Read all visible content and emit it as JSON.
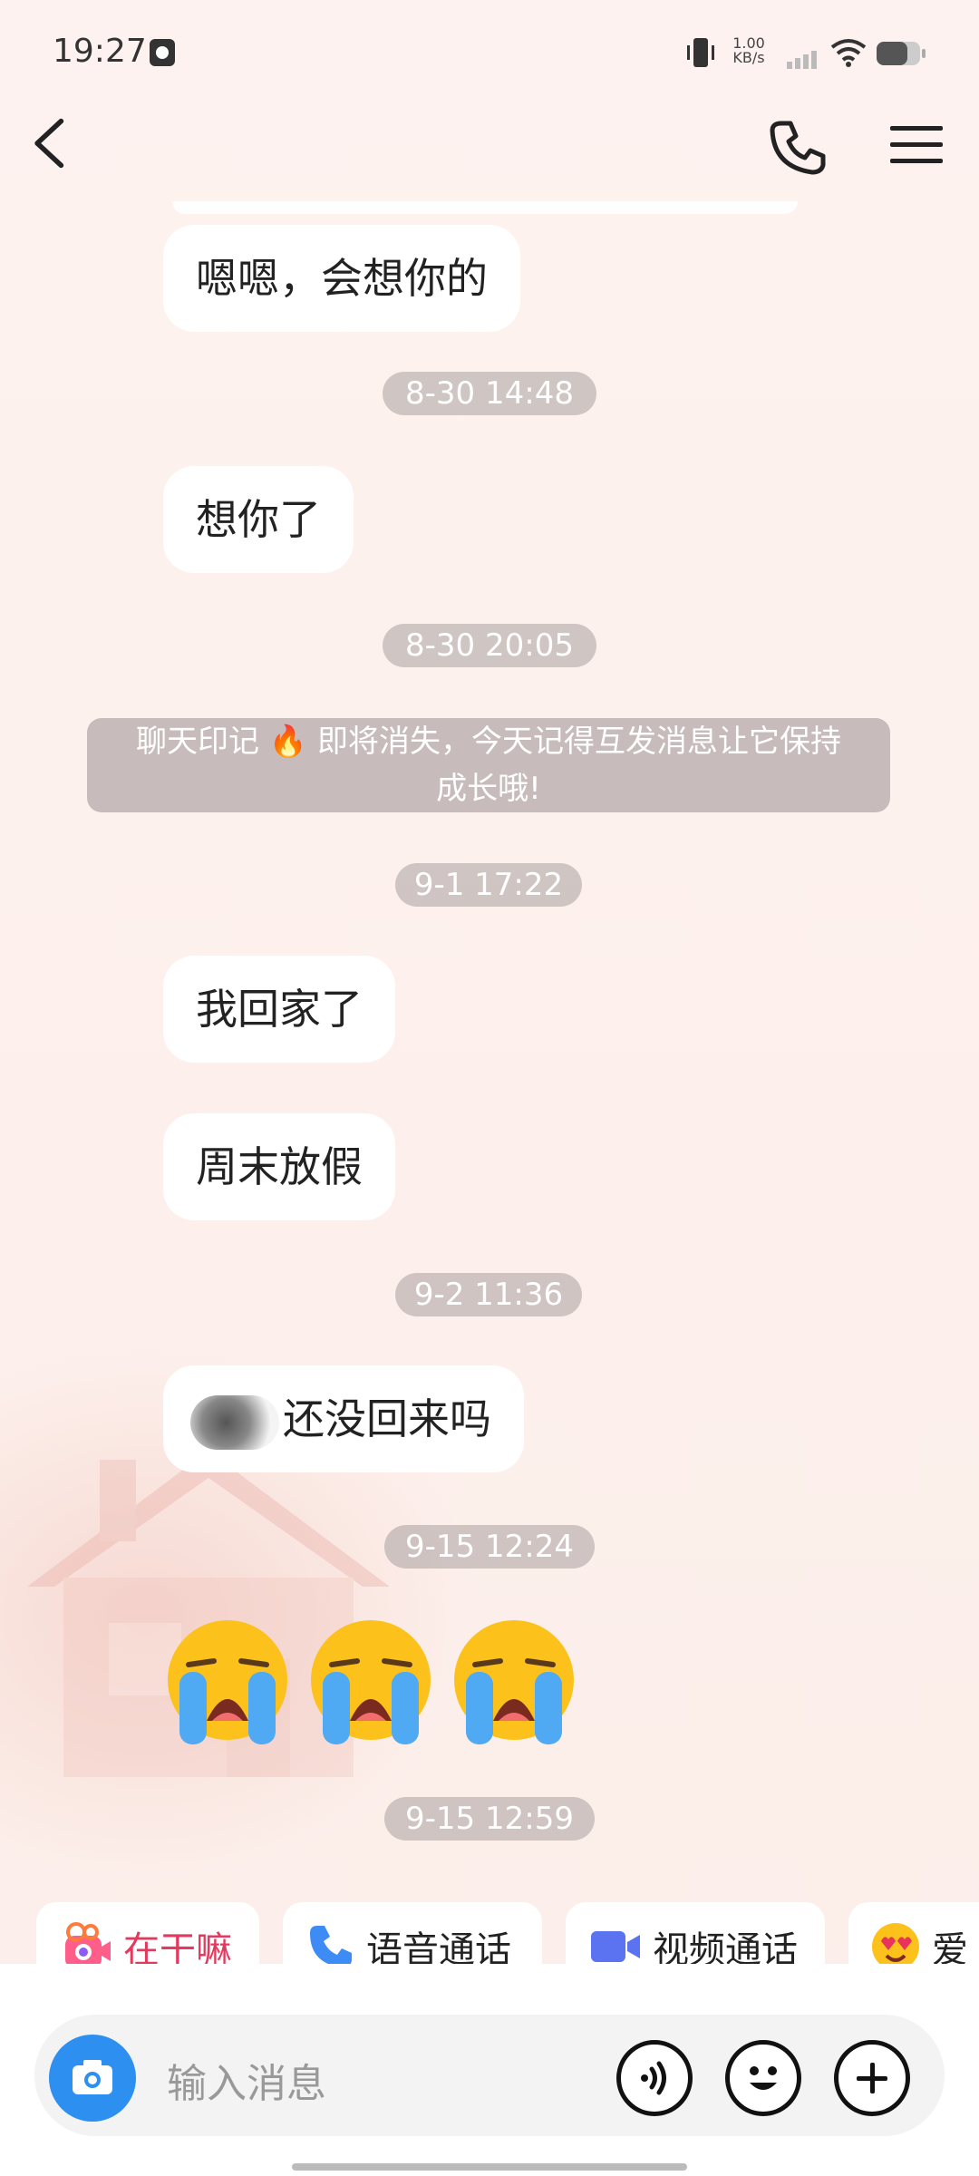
{
  "status": {
    "time": "19:27",
    "net_speed": "1.00",
    "net_unit": "KB/s"
  },
  "messages": [
    {
      "type": "text",
      "text": "嗯嗯，会想你的"
    },
    {
      "type": "time",
      "text": "8-30 14:48"
    },
    {
      "type": "text",
      "text": "想你了"
    },
    {
      "type": "time",
      "text": "8-30 20:05"
    },
    {
      "type": "system",
      "line1": "聊天印记 🔥 即将消失，今天记得互发消息让它保持",
      "line2": "成长哦!"
    },
    {
      "type": "time",
      "text": "9-1 17:22"
    },
    {
      "type": "text",
      "text": "我回家了"
    },
    {
      "type": "text",
      "text": "周末放假"
    },
    {
      "type": "time",
      "text": "9-2 11:36"
    },
    {
      "type": "text",
      "text": "还没回来吗"
    },
    {
      "type": "time",
      "text": "9-15 12:24"
    },
    {
      "type": "emoji",
      "text": "😭 😭 😭",
      "icons": [
        "loudly-crying-face-icon",
        "loudly-crying-face-icon",
        "loudly-crying-face-icon"
      ]
    },
    {
      "type": "time",
      "text": "9-15 12:59"
    }
  ],
  "quick_actions": [
    {
      "label": "在干嘛",
      "icon": "camera-sticker-icon"
    },
    {
      "label": "语音通话",
      "icon": "phone-icon"
    },
    {
      "label": "视频通话",
      "icon": "video-icon"
    },
    {
      "label": "爱",
      "icon": "heart-eyes-icon"
    }
  ],
  "input": {
    "placeholder": "输入消息"
  },
  "colors": {
    "accent": "#2d8ff0",
    "pink": "#e23a5e",
    "timestamp_bg": "#bfb8b8",
    "background": "#fdf1ee"
  }
}
